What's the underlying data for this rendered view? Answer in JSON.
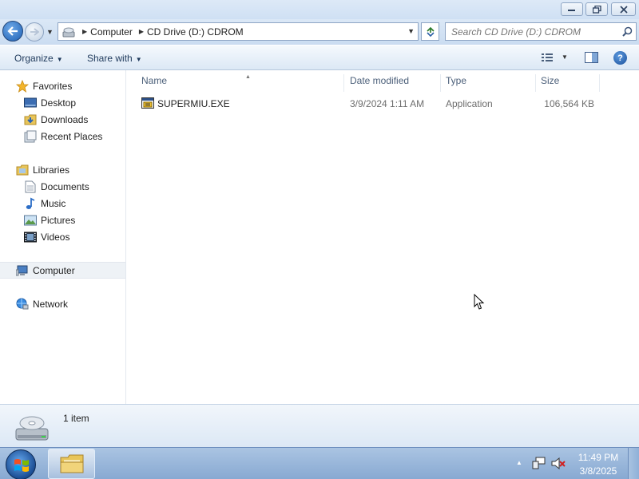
{
  "window": {
    "minimize_icon": "minimize-icon",
    "maximize_icon": "restore-icon",
    "close_icon": "close-icon"
  },
  "address": {
    "breadcrumbs": [
      "Computer",
      "CD Drive (D:) CDROM"
    ]
  },
  "search": {
    "placeholder": "Search CD Drive (D:) CDROM"
  },
  "toolbar": {
    "organize_label": "Organize",
    "share_label": "Share with"
  },
  "navpane": {
    "favorites": {
      "label": "Favorites",
      "items": [
        {
          "label": "Desktop",
          "icon": "desktop-icon"
        },
        {
          "label": "Downloads",
          "icon": "downloads-icon"
        },
        {
          "label": "Recent Places",
          "icon": "recent-places-icon"
        }
      ]
    },
    "libraries": {
      "label": "Libraries",
      "items": [
        {
          "label": "Documents",
          "icon": "documents-icon"
        },
        {
          "label": "Music",
          "icon": "music-icon"
        },
        {
          "label": "Pictures",
          "icon": "pictures-icon"
        },
        {
          "label": "Videos",
          "icon": "videos-icon"
        }
      ]
    },
    "computer": {
      "label": "Computer"
    },
    "network": {
      "label": "Network"
    }
  },
  "columns": {
    "name": "Name",
    "date": "Date modified",
    "type": "Type",
    "size": "Size"
  },
  "files": [
    {
      "name": "SUPERMIU.EXE",
      "date": "3/9/2024 1:11 AM",
      "type": "Application",
      "size": "106,564 KB"
    }
  ],
  "details": {
    "item_count": "1 item"
  },
  "taskbar": {
    "time": "11:49 PM",
    "date": "3/8/2025"
  }
}
